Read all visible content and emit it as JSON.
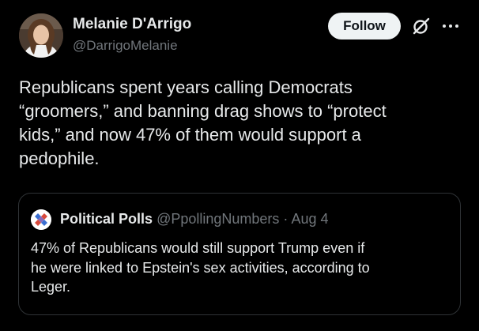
{
  "colors": {
    "background": "#000000",
    "primary_text": "#e7e9ea",
    "secondary_text": "#71767b",
    "border": "#2f3336",
    "follow_button_bg": "#eff3f4"
  },
  "tweet": {
    "author": {
      "name": "Melanie D'Arrigo",
      "handle": "@DarrigoMelanie",
      "avatar_icon": "profile-photo"
    },
    "follow_label": "Follow",
    "grok_icon": "grok-icon",
    "more_icon": "more-dots-icon",
    "text": "Republicans spent years calling Democrats\n“groomers,” and banning drag shows to “protect\nkids,” and now 47% of them would support a\npedophile."
  },
  "quote": {
    "avatar_icon": "political-polls-logo",
    "name": "Political Polls",
    "handle": "@PpollingNumbers",
    "separator": "·",
    "date": "Aug 4",
    "text": "47% of Republicans would still support Trump even if\nhe were linked to Epstein's sex activities, according to\nLeger."
  }
}
